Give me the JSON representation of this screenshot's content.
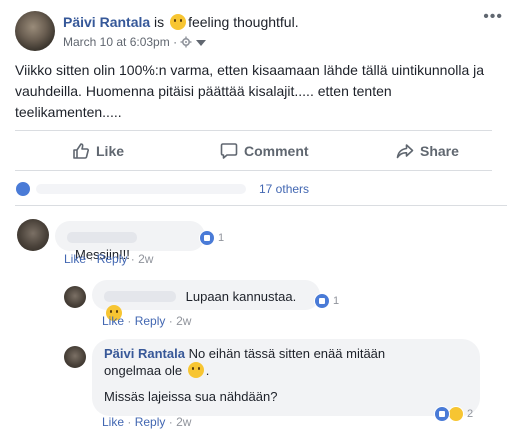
{
  "post": {
    "author": "Päivi Rantala",
    "is_word": "is",
    "feeling": "feeling thoughtful.",
    "timestamp": "March 10 at 6:03pm",
    "meta_sep": "·",
    "more_icon": "•••",
    "text": "Viikko sitten olin 100%:n varma, etten kisaamaan lähde tällä uintikunnolla ja vauhdeilla. Huomenna pitäisi päättää kisalajit..... etten tenten teelikamenten....."
  },
  "actions": {
    "like": "Like",
    "comment": "Comment",
    "share": "Share"
  },
  "reactions": {
    "others": "17 others"
  },
  "comments": [
    {
      "text": "Messiin!!!",
      "reaction_count": "1",
      "like": "Like",
      "reply": "Reply",
      "age": "2w"
    },
    {
      "text": "Lupaan kannustaa.",
      "reaction_count": "1",
      "like": "Like",
      "reply": "Reply",
      "age": "2w"
    },
    {
      "author": "Päivi Rantala",
      "text": "No eihän tässä sitten enää mitään ongelmaa ole",
      "text2": "Missäs lajeissa sua nähdään?",
      "reaction_count": "2",
      "like": "Like",
      "reply": "Reply",
      "age": "2w"
    }
  ],
  "colors": {
    "link": "#4267b2",
    "name": "#365899",
    "like_blue": "#4a7bd7",
    "emoji_yellow": "#f7c532"
  }
}
